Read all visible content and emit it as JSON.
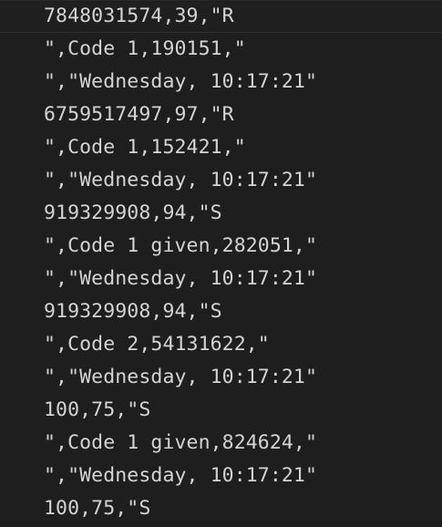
{
  "editor": {
    "lines": [
      "7848031574,39,\"R",
      "\",Code 1,190151,\"",
      "\",\"Wednesday, 10:17:21\"",
      "6759517497,97,\"R",
      "\",Code 1,152421,\"",
      "\",\"Wednesday, 10:17:21\"",
      "919329908,94,\"S",
      "\",Code 1 given,282051,\"",
      "\",\"Wednesday, 10:17:21\"",
      "919329908,94,\"S",
      "\",Code 2,54131622,\"",
      "\",\"Wednesday, 10:17:21\"",
      "100,75,\"S",
      "\",Code 1 given,824624,\"",
      "\",\"Wednesday, 10:17:21\"",
      "100,75,\"S"
    ]
  },
  "colors": {
    "background": "#1e1e1e",
    "text": "#d4d4d4"
  }
}
